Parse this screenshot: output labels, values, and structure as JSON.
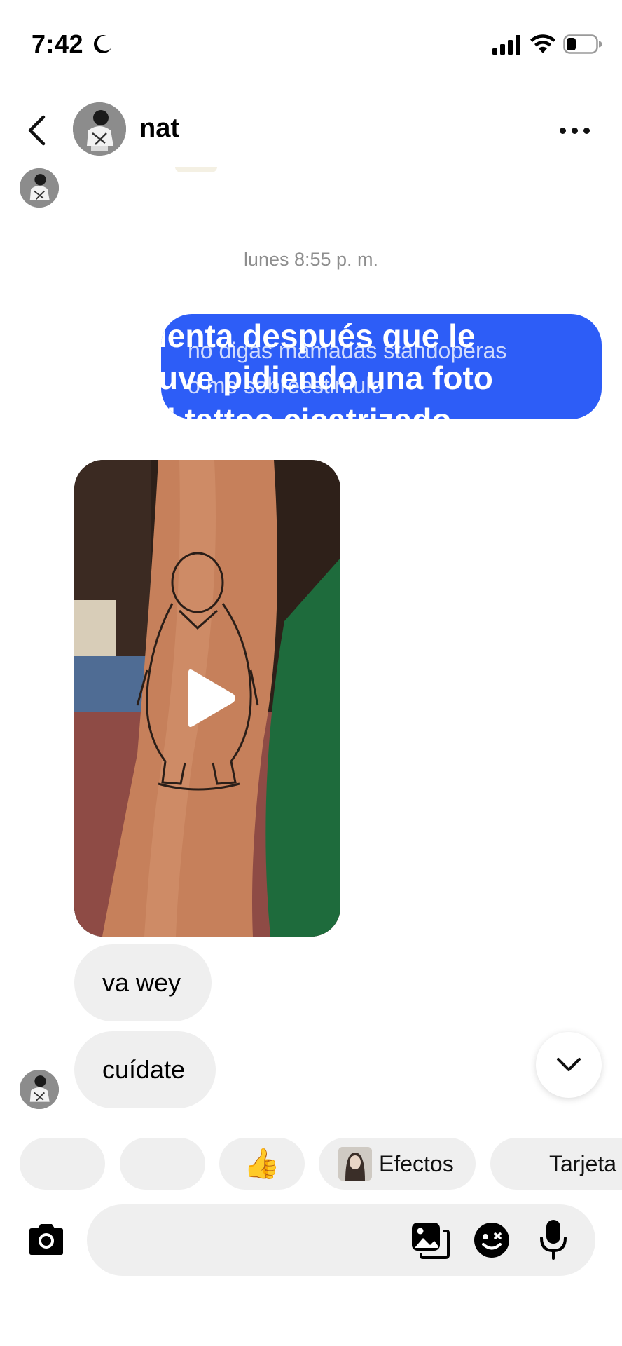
{
  "status_bar": {
    "time": "7:42"
  },
  "header": {
    "name": "nat"
  },
  "thread": {
    "timestamp": "lunes 8:55 p. m.",
    "outgoing_overlay": {
      "line1": "ienta después que le",
      "line2": "uve pidiendo una foto",
      "line3": "l tattoo cicatrizado",
      "sub1": "no digas mamadas standoperas",
      "sub2": "o me sobreestimulo"
    },
    "incoming": [
      "va wey",
      "cuídate"
    ]
  },
  "quick_replies": {
    "emoji": "👍",
    "effects": "Efectos",
    "cards": "Tarjeta"
  },
  "composer": {
    "placeholder": ""
  },
  "colors": {
    "accent": "#2d5df7",
    "bubble_gray": "#efefef",
    "timestamp": "#8e8e8e"
  }
}
